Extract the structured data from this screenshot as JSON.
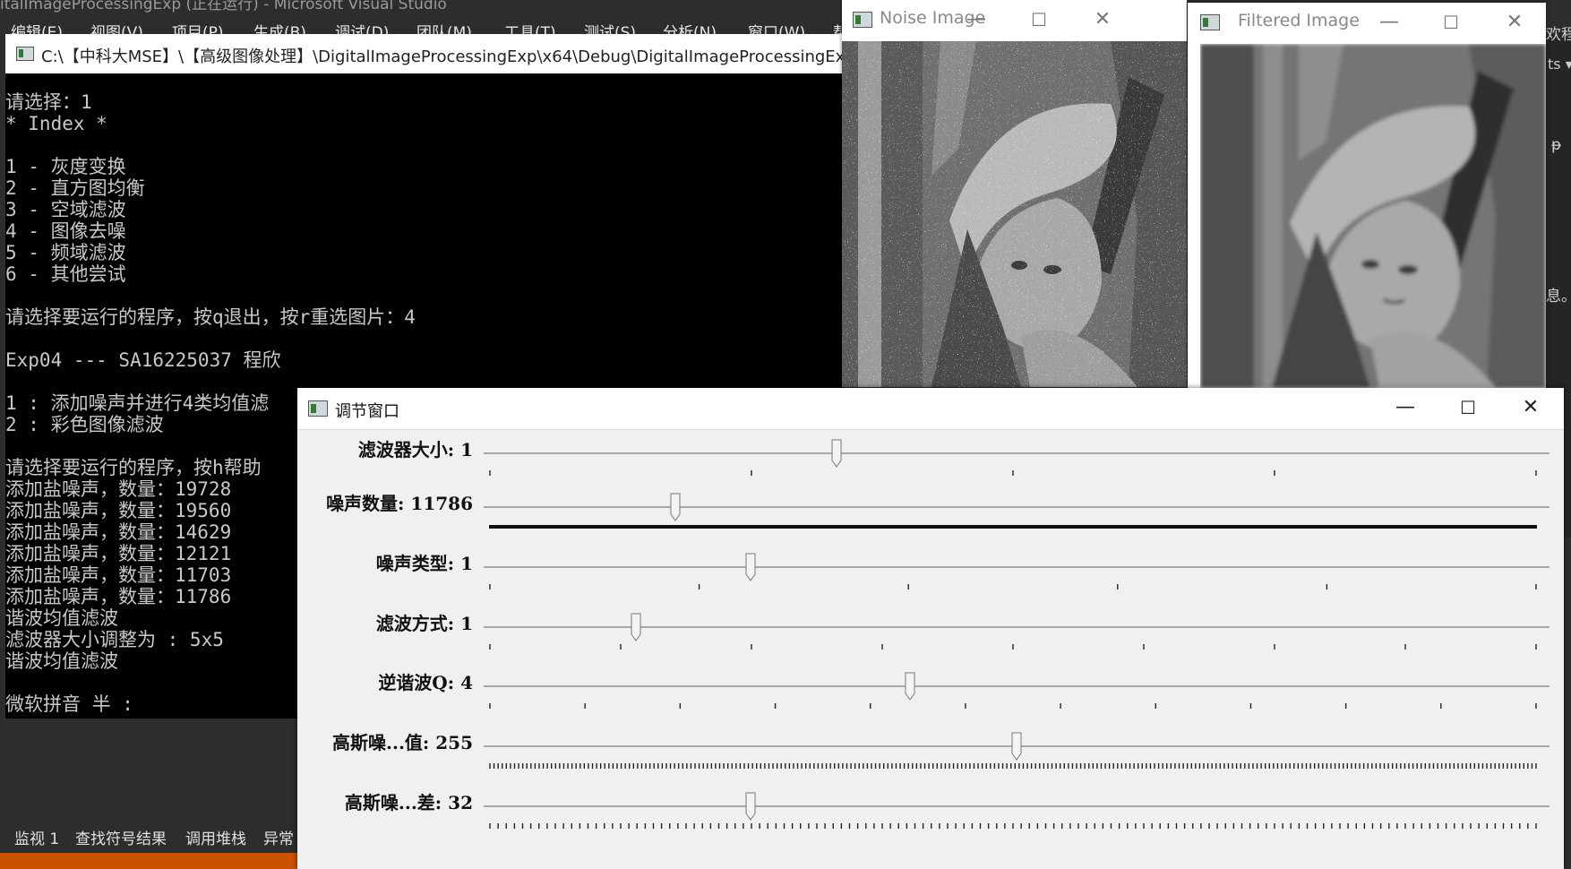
{
  "vs": {
    "title": "italImageProcessingExp (正在运行) - Microsoft Visual Studio",
    "menu": [
      "编辑(E)",
      "视图(V)",
      "项目(P)",
      "生成(B)",
      "调试(D)",
      "团队(M)",
      "工具(T)",
      "测试(S)",
      "分析(N)",
      "窗口(W)",
      "帮"
    ],
    "right_edge": [
      "欢程",
      "ts ▾",
      "ᵽ",
      "息。"
    ],
    "bottom_tabs": [
      "监视 1",
      "查找符号结果",
      "调用堆栈",
      "异常"
    ],
    "colors": {
      "statusbar": "#ca5100",
      "background": "#2d2d30"
    }
  },
  "console": {
    "title": "C:\\【中科大MSE】\\【高级图像处理】\\DigitalImageProcessingExp\\x64\\Debug\\DigitalImageProcessingExp.",
    "icon": "console-icon",
    "lines": [
      "请选择：1",
      "* Index *",
      "",
      "1 - 灰度变换",
      "2 - 直方图均衡",
      "3 - 空域滤波",
      "4 - 图像去噪",
      "5 - 频域滤波",
      "6 - 其他尝试",
      "",
      "请选择要运行的程序，按q退出，按r重选图片：4",
      "",
      "Exp04 --- SA16225037 程欣",
      "",
      "1 : 添加噪声并进行4类均值滤",
      "2 : 彩色图像滤波",
      "",
      "请选择要运行的程序，按h帮助",
      "添加盐噪声，数量：19728",
      "添加盐噪声，数量：19560",
      "添加盐噪声，数量：14629",
      "添加盐噪声，数量：12121",
      "添加盐噪声，数量：11703",
      "添加盐噪声，数量：11786",
      "谐波均值滤波",
      "滤波器大小调整为 : 5x5",
      "谐波均值滤波",
      "",
      "微软拼音 半 :"
    ]
  },
  "noise_window": {
    "title": "Noise Image",
    "icon": "opencv-window-icon"
  },
  "filtered_window": {
    "title": "Filtered Image",
    "icon": "opencv-window-icon"
  },
  "window_controls": {
    "minimize": "—",
    "maximize": "☐",
    "close": "✕"
  },
  "trackbar_window": {
    "title": "调节窗口",
    "trackbars": [
      {
        "label": "滤波器大小: 1",
        "position": 0.331,
        "ticks": 4,
        "tick_style": "sparse"
      },
      {
        "label": "噪声数量: 11786",
        "position": 0.18,
        "ticks": 0,
        "tick_style": "solid"
      },
      {
        "label": "噪声类型: 1",
        "position": 0.25,
        "ticks": 5,
        "tick_style": "sparse"
      },
      {
        "label": "滤波方式: 1",
        "position": 0.143,
        "ticks": 8,
        "tick_style": "sparse"
      },
      {
        "label": "逆谐波Q: 4",
        "position": 0.4,
        "ticks": 11,
        "tick_style": "sparse"
      },
      {
        "label": "高斯噪...值: 255",
        "position": 0.5,
        "ticks": 255,
        "tick_style": "dense"
      },
      {
        "label": "高斯噪...差: 32",
        "position": 0.25,
        "ticks": 128,
        "tick_style": "dense"
      }
    ]
  }
}
